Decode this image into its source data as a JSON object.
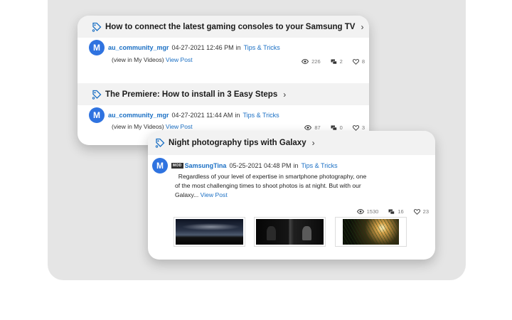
{
  "posts": [
    {
      "title": "How to connect the latest gaming consoles to your Samsung TV",
      "avatar_letter": "M",
      "username": "au_community_mgr",
      "date": "04-27-2021 12:46 PM",
      "in_text": "in",
      "board": "Tips & Tricks",
      "body_prefix": "(view in My Videos)",
      "view_post": "View Post",
      "views": "226",
      "replies": "2",
      "likes": "8"
    },
    {
      "title": "The Premiere: How to install in 3 Easy Steps",
      "avatar_letter": "M",
      "username": "au_community_mgr",
      "date": "04-27-2021 11:44 AM",
      "in_text": "in",
      "board": "Tips & Tricks",
      "body_prefix": "(view in My Videos)",
      "view_post": "View Post",
      "views": "87",
      "replies": "0",
      "likes": "3"
    }
  ],
  "featured": {
    "title": "Night photography tips with Galaxy",
    "avatar_letter": "M",
    "rank_badge": "MOD",
    "username": "SamsungTina",
    "date": "05-25-2021 04:48 PM",
    "in_text": "in",
    "board": "Tips & Tricks",
    "excerpt": "Regardless of your level of expertise in smartphone photography, one of the most challenging times to shoot photos is at night. But with our Galaxy...",
    "view_post": "View Post",
    "views": "1530",
    "replies": "16",
    "likes": "23"
  },
  "icons": {
    "title": "tag-icon",
    "views": "eye-icon",
    "replies": "comments-icon",
    "likes": "heart-icon",
    "chevron": "chevron-right-icon"
  },
  "colors": {
    "link": "#1a6fc4",
    "avatar": "#2f73e0",
    "title_bar": "#f2f2f2"
  }
}
